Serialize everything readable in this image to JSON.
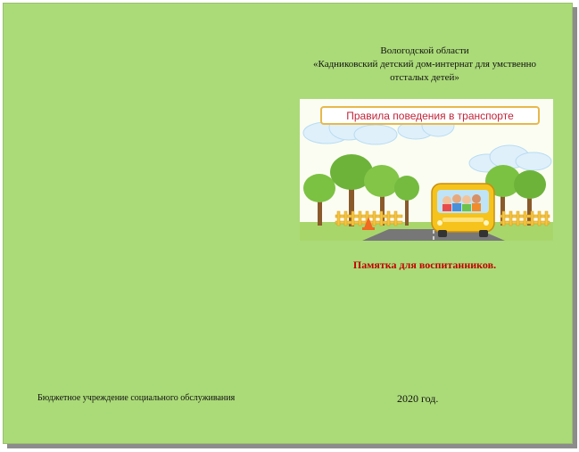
{
  "document": {
    "header_line1": "Вологодской области",
    "header_line2": "«Кадниковский детский дом-интернат для умственно",
    "header_line3": "отсталых детей»",
    "image_banner": "Правила поведения в транспорте",
    "memo_title": "Памятка для воспитанников.",
    "footer_left": "Бюджетное учреждение социального обслуживания",
    "footer_year": "2020 год."
  },
  "colors": {
    "page_background": "#abdb78",
    "memo_title": "#c00000",
    "banner_border": "#e8b84a",
    "bus": "#f5c31c"
  },
  "icons": [
    "school-bus-illustration"
  ]
}
